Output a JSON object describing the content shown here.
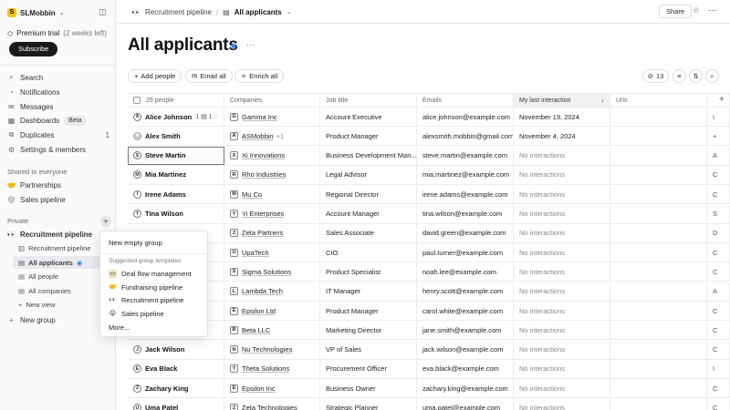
{
  "workspace": {
    "name": "SLMobbin",
    "logo_letter": "S"
  },
  "trial": {
    "label": "Premium trial",
    "sub": "(2 weeks left)",
    "subscribe": "Subscribe"
  },
  "nav": [
    {
      "label": "Search",
      "icon": "search-icon",
      "count": ""
    },
    {
      "label": "Notifications",
      "icon": "bell-icon",
      "count": ""
    },
    {
      "label": "Messages",
      "icon": "envelope-icon",
      "count": ""
    },
    {
      "label": "Dashboards",
      "icon": "dashboard-icon",
      "badge": "Beta"
    },
    {
      "label": "Duplicates",
      "icon": "duplicate-icon",
      "count": "1"
    },
    {
      "label": "Settings & members",
      "icon": "gear-icon",
      "count": ""
    }
  ],
  "shared": {
    "title": "Shared to everyone",
    "items": [
      "Partnerships",
      "Sales pipeline"
    ]
  },
  "private": {
    "title": "Private",
    "group": "Recruitment pipeline",
    "subitems": [
      "Recruitment pipeline",
      "All applicants",
      "All people",
      "All companies",
      "New view"
    ],
    "new_group": "New group"
  },
  "menu": {
    "new_empty": "New empty group",
    "section": "Suggested group templates",
    "templates": [
      "Deal flow management",
      "Fundraising pipeline",
      "Recruitment pipeline",
      "Sales pipeline"
    ],
    "more": "More..."
  },
  "breadcrumb": {
    "parent": "Recruitment pipeline",
    "current": "All applicants"
  },
  "topbar": {
    "share": "Share"
  },
  "page": {
    "title": "All applicants"
  },
  "toolbar": {
    "add_people": "Add people",
    "email_all": "Email all",
    "enrich_all": "Enrich all",
    "hidden_count": "13"
  },
  "table": {
    "headers": [
      "29 people",
      "Companies",
      "Job title",
      "Emails",
      "My last interaction",
      "Urls"
    ],
    "rows": [
      {
        "name": "Alice Johnson",
        "initial": "A",
        "meta": "1 ▤ 1 ◌",
        "company": "Gamma Inc",
        "company_initial": "G",
        "extra": "",
        "title": "Account Executive",
        "email": "alice.johnson@example.com",
        "interaction": "November 19, 2024",
        "edge": "I"
      },
      {
        "name": "Alex Smith",
        "initial": "A",
        "meta": "",
        "company": "ASMobbin",
        "company_initial": "A",
        "extra": "+1",
        "title": "Product Manager",
        "email": "alexsmith.mobbin@gmail.com",
        "interaction": "November 4, 2024",
        "edge": "+"
      },
      {
        "name": "Steve Martin",
        "initial": "S",
        "meta": "",
        "company": "Xi Innovations",
        "company_initial": "X",
        "extra": "",
        "title": "Business Development Man...",
        "email": "steve.martin@example.com",
        "interaction": "No interactions",
        "edge": "A"
      },
      {
        "name": "Mia Martinez",
        "initial": "M",
        "meta": "",
        "company": "Rho Industries",
        "company_initial": "R",
        "extra": "",
        "title": "Legal Advisor",
        "email": "mia.martinez@example.com",
        "interaction": "No interactions",
        "edge": "C"
      },
      {
        "name": "Irene Adams",
        "initial": "I",
        "meta": "",
        "company": "Mu Co",
        "company_initial": "M",
        "extra": "",
        "title": "Regional Director",
        "email": "irene.adams@example.com",
        "interaction": "No interactions",
        "edge": "C"
      },
      {
        "name": "Tina Wilson",
        "initial": "T",
        "meta": "",
        "company": "Yi Enterprises",
        "company_initial": "Y",
        "extra": "",
        "title": "Account Manager",
        "email": "tina.wilson@example.com",
        "interaction": "No interactions",
        "edge": "S"
      },
      {
        "name": "",
        "initial": "",
        "meta": "",
        "company": "Zeta Partners",
        "company_initial": "Z",
        "extra": "",
        "title": "Sales Associate",
        "email": "david.green@example.com",
        "interaction": "No interactions",
        "edge": "D"
      },
      {
        "name": "",
        "initial": "",
        "meta": "",
        "company": "UpaTech",
        "company_initial": "U",
        "extra": "",
        "title": "CIO",
        "email": "paul.turner@example.com",
        "interaction": "No interactions",
        "edge": "C"
      },
      {
        "name": "",
        "initial": "",
        "meta": "",
        "company": "Sigma Solutions",
        "company_initial": "S",
        "extra": "",
        "title": "Product Specialist",
        "email": "noah.lee@example.com",
        "interaction": "No interactions",
        "edge": "C"
      },
      {
        "name": "",
        "initial": "",
        "meta": "",
        "company": "Lambda Tech",
        "company_initial": "L",
        "extra": "",
        "title": "IT Manager",
        "email": "henry.scott@example.com",
        "interaction": "No interactions",
        "edge": "A"
      },
      {
        "name": "",
        "initial": "",
        "meta": "",
        "company": "Epsilon Ltd",
        "company_initial": "E",
        "extra": "",
        "title": "Product Manager",
        "email": "carol.white@example.com",
        "interaction": "No interactions",
        "edge": "C"
      },
      {
        "name": "",
        "initial": "",
        "meta": "",
        "company": "Beta LLC",
        "company_initial": "B",
        "extra": "",
        "title": "Marketing Director",
        "email": "jane.smith@example.com",
        "interaction": "No interactions",
        "edge": "C"
      },
      {
        "name": "Jack Wilson",
        "initial": "J",
        "meta": "",
        "company": "Nu Technologies",
        "company_initial": "N",
        "extra": "",
        "title": "VP of Sales",
        "email": "jack.wilson@example.com",
        "interaction": "No interactions",
        "edge": "C"
      },
      {
        "name": "Eva Black",
        "initial": "E",
        "meta": "",
        "company": "Theta Solutions",
        "company_initial": "T",
        "extra": "",
        "title": "Procurement Officer",
        "email": "eva.black@example.com",
        "interaction": "No interactions",
        "edge": "I"
      },
      {
        "name": "Zachary King",
        "initial": "Z",
        "meta": "",
        "company": "Epsilon Inc",
        "company_initial": "E",
        "extra": "",
        "title": "Business Owner",
        "email": "zachary.king@example.com",
        "interaction": "No interactions",
        "edge": "C"
      },
      {
        "name": "Uma Patel",
        "initial": "U",
        "meta": "",
        "company": "Zeta Technologies",
        "company_initial": "Z",
        "extra": "",
        "title": "Strategic Planner",
        "email": "uma.patel@example.com",
        "interaction": "No interactions",
        "edge": "C"
      }
    ]
  }
}
